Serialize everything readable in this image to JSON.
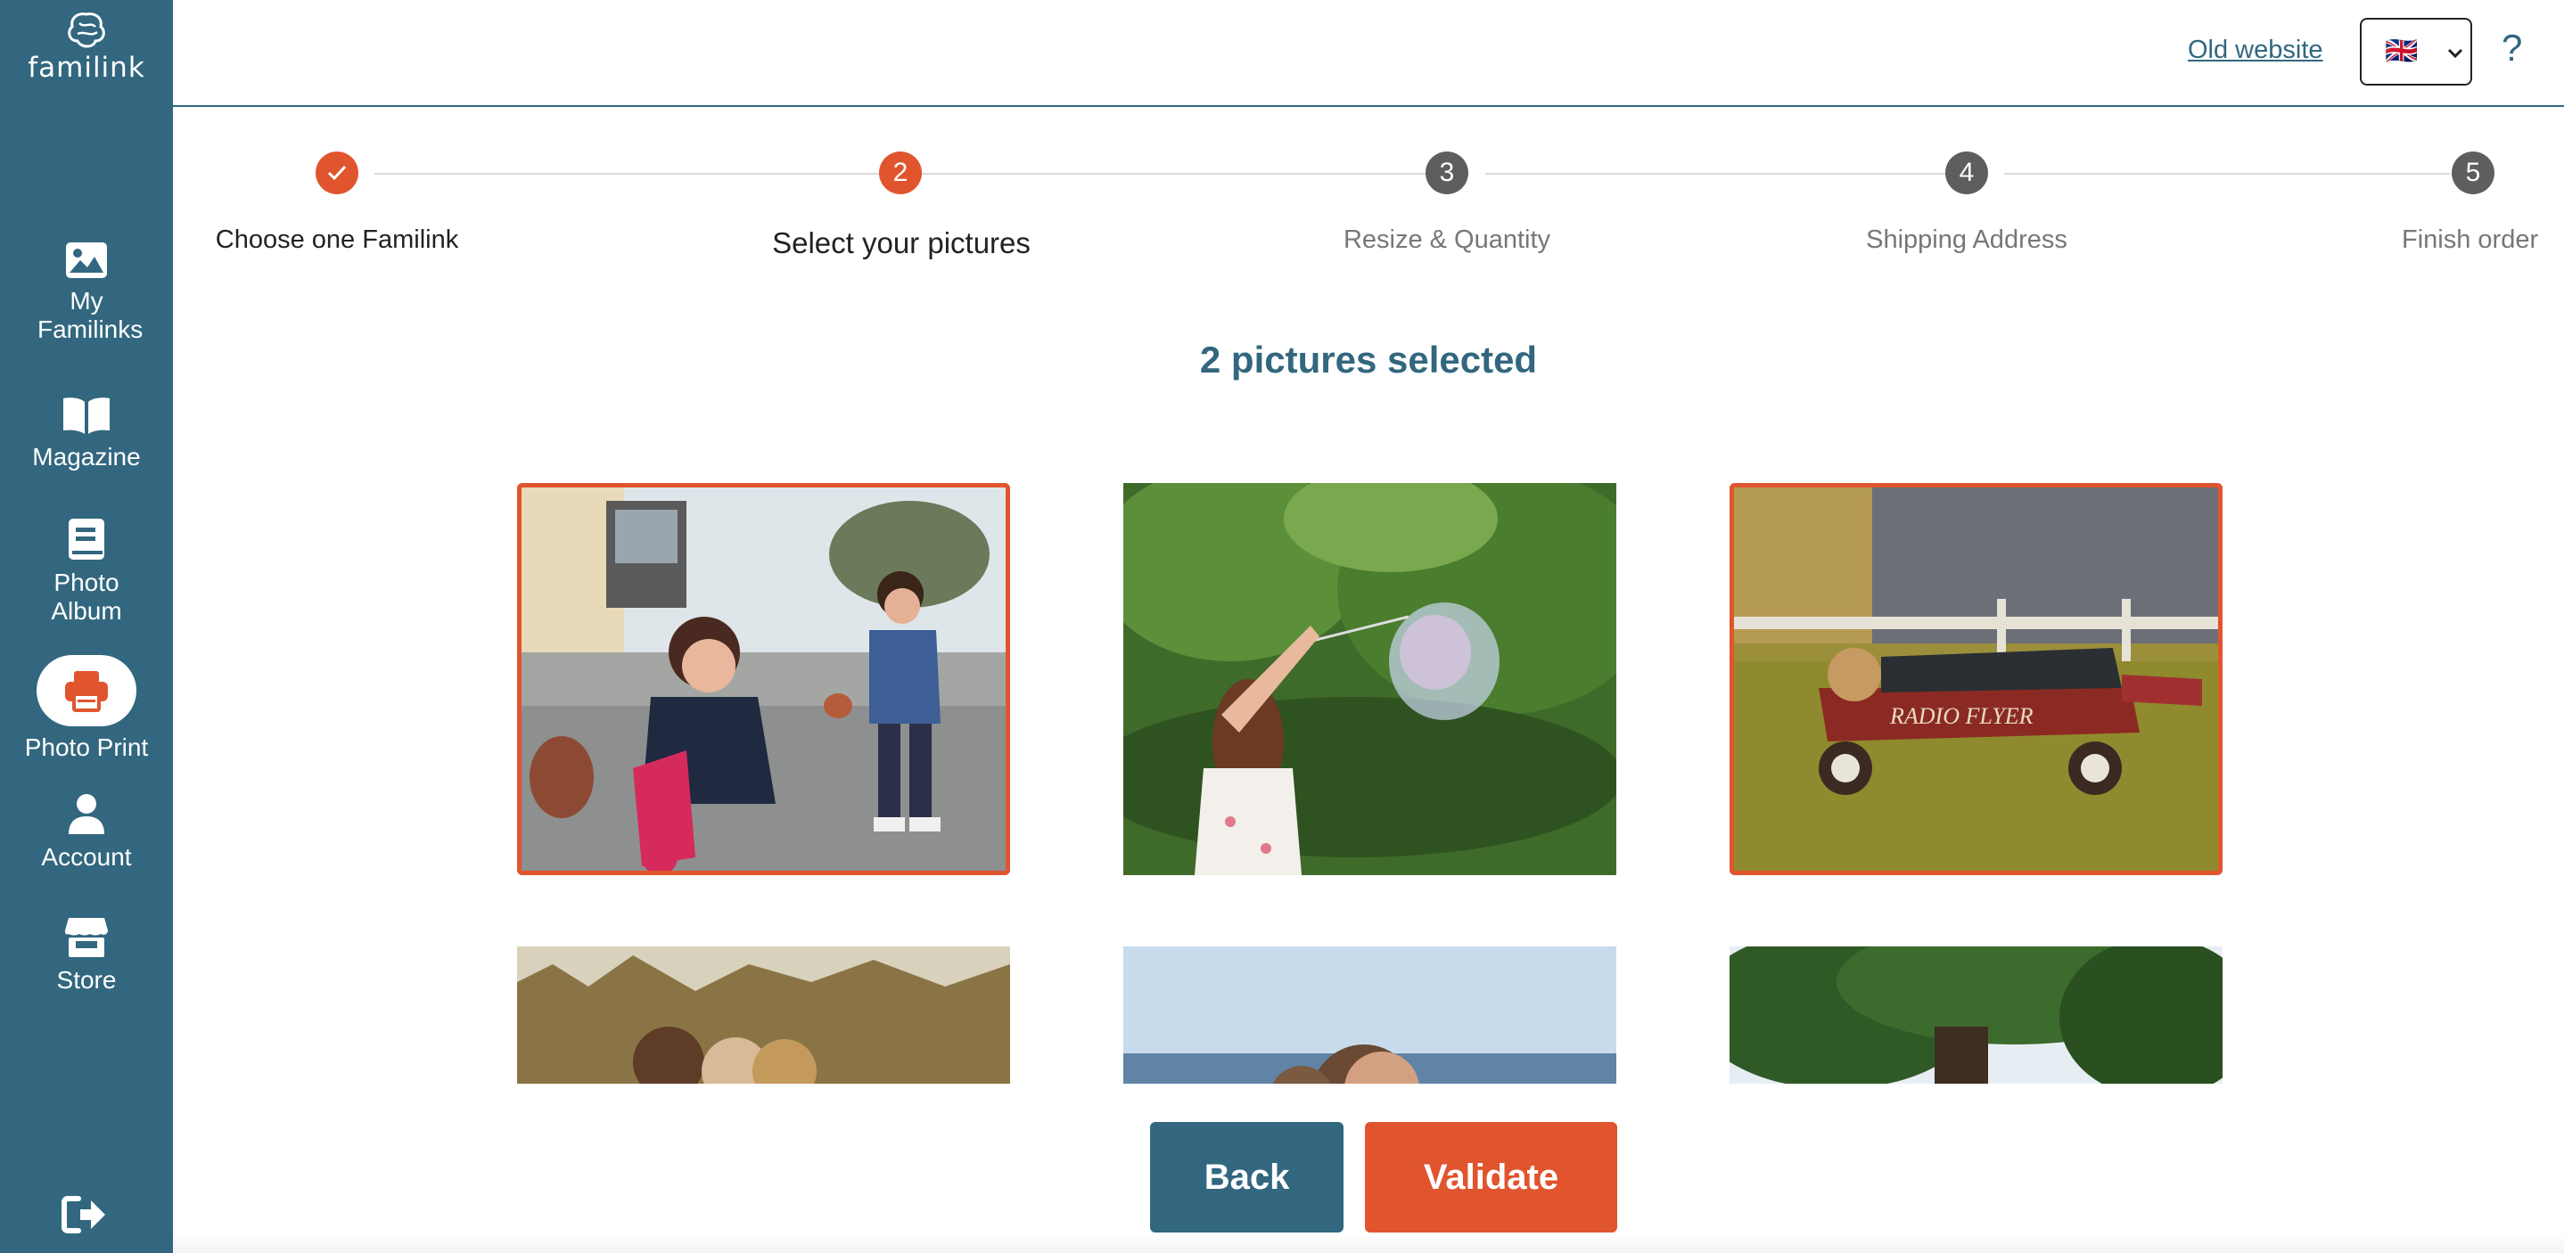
{
  "sidebar": {
    "logo_text": "familink",
    "items": [
      {
        "label": "My Familinks",
        "icon": "image-icon",
        "active": false
      },
      {
        "label": "Magazine",
        "icon": "book-open-icon",
        "active": false
      },
      {
        "label": "Photo Album",
        "icon": "album-icon",
        "active": false
      },
      {
        "label": "Photo Print",
        "icon": "printer-icon",
        "active": true
      },
      {
        "label": "Account",
        "icon": "user-icon",
        "active": false
      },
      {
        "label": "Store",
        "icon": "store-icon",
        "active": false
      }
    ],
    "logout_icon": "logout-icon"
  },
  "topbar": {
    "old_website_label": "Old website",
    "language_flag": "🇬🇧",
    "help_label": "?"
  },
  "stepper": {
    "steps": [
      {
        "number": "✓",
        "label": "Choose one Familink",
        "state": "done"
      },
      {
        "number": "2",
        "label": "Select your pictures",
        "state": "current"
      },
      {
        "number": "3",
        "label": "Resize & Quantity",
        "state": "upcoming"
      },
      {
        "number": "4",
        "label": "Shipping Address",
        "state": "upcoming"
      },
      {
        "number": "5",
        "label": "Finish order",
        "state": "upcoming"
      }
    ]
  },
  "selection": {
    "summary": "2 pictures selected",
    "photos": [
      {
        "name": "photo-girls-bike",
        "selected": true
      },
      {
        "name": "photo-girl-bubble",
        "selected": false
      },
      {
        "name": "photo-kids-wagon",
        "selected": true
      },
      {
        "name": "photo-couple-field",
        "selected": false
      },
      {
        "name": "photo-beach-family",
        "selected": false
      },
      {
        "name": "photo-tree",
        "selected": false
      }
    ]
  },
  "wagon_text": "RADIO FLYER",
  "actions": {
    "back_label": "Back",
    "validate_label": "Validate"
  },
  "colors": {
    "brand_blue": "#32677f",
    "accent_orange": "#e0552e",
    "step_gray": "#5e5e5e"
  }
}
